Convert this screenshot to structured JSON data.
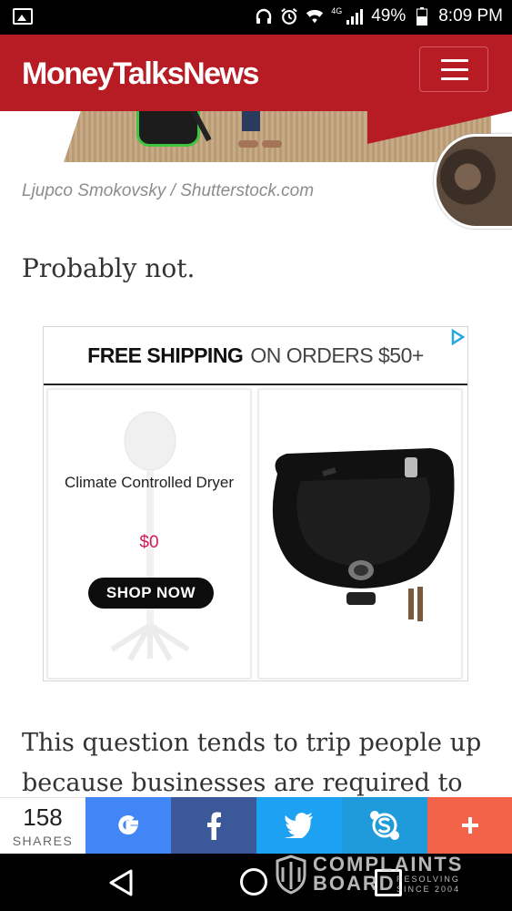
{
  "status_bar": {
    "network": "4G",
    "battery": "49%",
    "time": "8:09 PM",
    "icons": [
      "gallery-icon",
      "headphones-icon",
      "alarm-icon",
      "wifi-icon",
      "signal-icon",
      "battery-icon"
    ]
  },
  "header": {
    "logo": "MoneyTalksNews",
    "menu_icon": "hamburger-icon",
    "brand_color": "#b71c25"
  },
  "article": {
    "image_caption": "Ljupco Smokovsky / Shutterstock.com",
    "paragraph_1": "Probably not.",
    "paragraph_2": "This question tends to trip people up because businesses are required to be"
  },
  "ad": {
    "banner_bold": "FREE SHIPPING",
    "banner_rest": "ON ORDERS $50+",
    "product_1": {
      "title": "Climate Controlled Dryer",
      "price": "$0",
      "cta": "SHOP NOW"
    },
    "product_2": {
      "image": "black-shampoo-bowl"
    },
    "adchoices_icon": "adchoices-icon"
  },
  "share_bar": {
    "count": "158",
    "count_label": "SHARES",
    "buttons": [
      {
        "icon": "google-icon",
        "color": "#4285f4"
      },
      {
        "icon": "facebook-icon",
        "color": "#3b5998"
      },
      {
        "icon": "twitter-icon",
        "color": "#1da1f2"
      },
      {
        "icon": "skype-icon",
        "color": "#1f9bdc"
      },
      {
        "icon": "plus-icon",
        "color": "#f2634a"
      }
    ]
  },
  "watermark": {
    "line1": "COMPLAINTS",
    "line2": "BOARD",
    "tag1": "RESOLVING",
    "tag2": "SINCE 2004"
  },
  "nav_bar": {
    "icons": [
      "back-icon",
      "home-icon",
      "recents-icon"
    ]
  }
}
